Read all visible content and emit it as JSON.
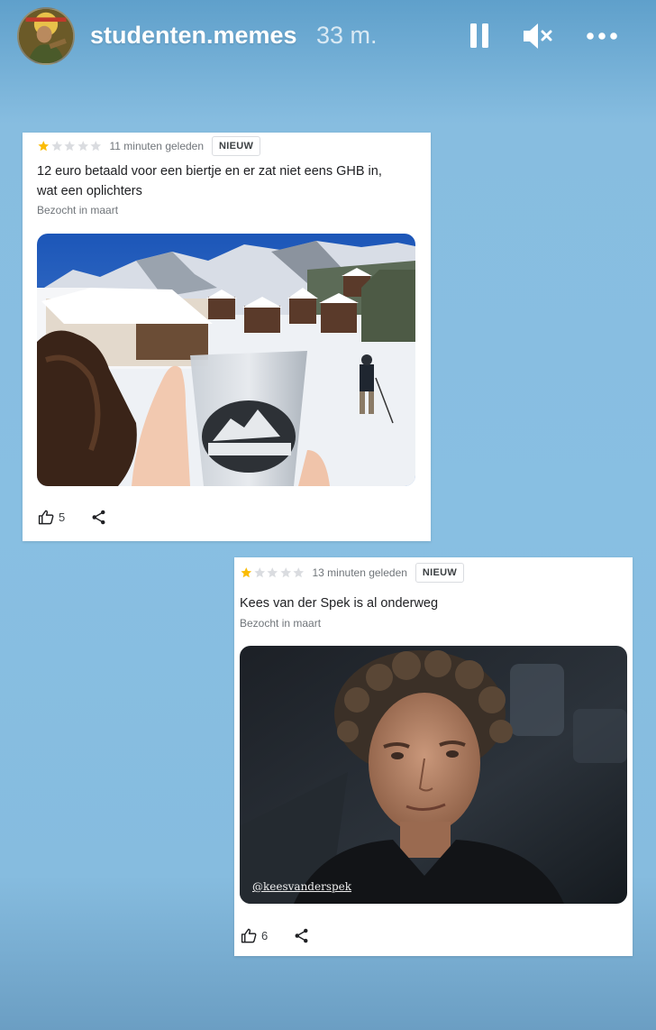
{
  "story": {
    "username": "studenten.memes",
    "time_ago": "33 m.",
    "controls": {
      "pause_icon": "pause-icon",
      "mute_icon": "speaker-muted-icon",
      "more_icon": "more-dots-icon"
    }
  },
  "reviews": [
    {
      "rating": 1,
      "rating_max": 5,
      "age": "11 minuten geleden",
      "badge": "NIEUW",
      "text_line1": "12 euro betaald voor een biertje en er zat niet eens GHB in,",
      "text_line2": "wat een oplichters",
      "visited": "Bezocht in maart",
      "photo": "ski-resort-shot-glass-photo",
      "likes": "5"
    },
    {
      "rating": 1,
      "rating_max": 5,
      "age": "13 minuten geleden",
      "badge": "NIEUW",
      "text_line1": "Kees van der Spek is al onderweg",
      "visited": "Bezocht in maart",
      "photo": "portrait-photo",
      "watermark": "@keesvanderspek",
      "likes": "6"
    }
  ],
  "colors": {
    "star_filled": "#fbbc04",
    "star_empty": "#dadce0",
    "background": "#88bfe2"
  }
}
